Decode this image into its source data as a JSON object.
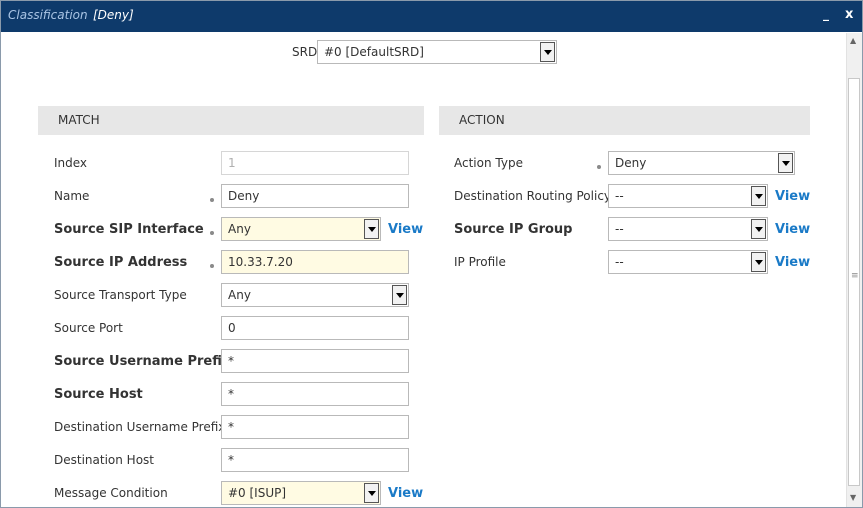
{
  "window": {
    "title": "Classification",
    "record": "[Deny]",
    "minimize_glyph": "_",
    "close_glyph": "x"
  },
  "srd": {
    "label": "SRD",
    "value": "#0 [DefaultSRD]"
  },
  "match": {
    "header": "MATCH",
    "fields": {
      "index": {
        "label": "Index",
        "value": "1"
      },
      "name": {
        "label": "Name",
        "value": "Deny"
      },
      "source_sip_interface": {
        "label": "Source SIP Interface",
        "value": "Any"
      },
      "source_ip_address": {
        "label": "Source IP Address",
        "value": "10.33.7.20"
      },
      "source_transport_type": {
        "label": "Source Transport Type",
        "value": "Any"
      },
      "source_port": {
        "label": "Source Port",
        "value": "0"
      },
      "source_username_prefix": {
        "label": "Source Username Prefix",
        "value": "*"
      },
      "source_host": {
        "label": "Source Host",
        "value": "*"
      },
      "destination_username_prefix": {
        "label": "Destination Username Prefix",
        "value": "*"
      },
      "destination_host": {
        "label": "Destination Host",
        "value": "*"
      },
      "message_condition": {
        "label": "Message Condition",
        "value": "#0 [ISUP]"
      }
    }
  },
  "action": {
    "header": "ACTION",
    "fields": {
      "action_type": {
        "label": "Action Type",
        "value": "Deny"
      },
      "destination_routing_policy": {
        "label": "Destination Routing Policy",
        "value": "--"
      },
      "source_ip_group": {
        "label": "Source IP Group",
        "value": "--"
      },
      "ip_profile": {
        "label": "IP Profile",
        "value": "--"
      }
    }
  },
  "view_label": "View",
  "icons": {
    "dropdown": "chevron-down-icon",
    "required": "bullet-icon",
    "scroll_up": "scroll-up-arrow-icon",
    "scroll_down": "scroll-down-arrow-icon"
  },
  "colors": {
    "titlebar": "#0e3a6b",
    "link": "#1a7ac7",
    "highlight_field": "#fffbe3",
    "section_header": "#e7e7e7"
  }
}
